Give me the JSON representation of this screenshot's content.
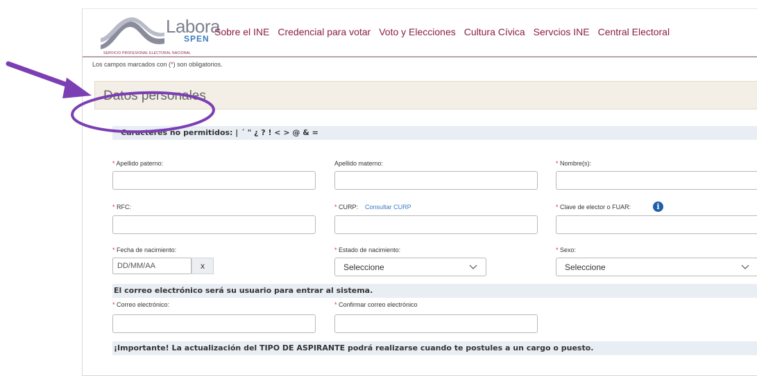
{
  "brand": {
    "name": "Labora",
    "suffix": "SPEN",
    "subtitle": "SERVICIO PROFESIONAL ELECTORAL NACIONAL"
  },
  "nav": {
    "items": [
      {
        "label": "Sobre el INE"
      },
      {
        "label": "Credencial para votar"
      },
      {
        "label": "Voto y Elecciones"
      },
      {
        "label": "Cultura Cívica"
      },
      {
        "label": "Servcios INE"
      },
      {
        "label": "Central Electoral"
      }
    ]
  },
  "notice": {
    "before": "Los campos marcados con (",
    "mark": "*",
    "after": ") son obligatorios."
  },
  "section": {
    "title": "Datos personales"
  },
  "banners": {
    "chars": "Caracteres no permitidos: | ´ \" ¿ ? ! < > @ & =",
    "email": "El correo electrónico será su usuario para entrar al sistema.",
    "important": "¡Importante! La actualización del TIPO DE ASPIRANTE podrá realizarse cuando te postules a un cargo o puesto."
  },
  "fields": {
    "apellido_paterno": {
      "label": "Apellido paterno:"
    },
    "apellido_materno": {
      "label": "Apellido materno:"
    },
    "nombre": {
      "label": "Nombre(s):"
    },
    "rfc": {
      "label": "RFC:"
    },
    "curp": {
      "label": "CURP:",
      "link": "Consultar CURP"
    },
    "clave_elector": {
      "label": "Clave de elector o FUAR:"
    },
    "fecha_nacimiento": {
      "label": "Fecha de nacimiento:",
      "placeholder": "DD/MM/AA",
      "clear": "x"
    },
    "estado_nacimiento": {
      "label": "Estado de nacimiento:",
      "value": "Seleccione"
    },
    "sexo": {
      "label": "Sexo:",
      "value": "Seleccione"
    },
    "correo": {
      "label": "Correo electrónico:"
    },
    "confirmar_correo": {
      "label": "Confirmar correo electrónico"
    }
  },
  "required_mark": "*",
  "colors": {
    "nav": "#8b1e3f",
    "required": "#d32f2f",
    "link": "#3b7bbf",
    "banner_bg": "#e8eef4",
    "section_bg": "#f4efe6",
    "annotation": "#7b3fb3"
  },
  "icons": {
    "info": "info-circle-icon",
    "chevron": "chevron-down-icon"
  }
}
